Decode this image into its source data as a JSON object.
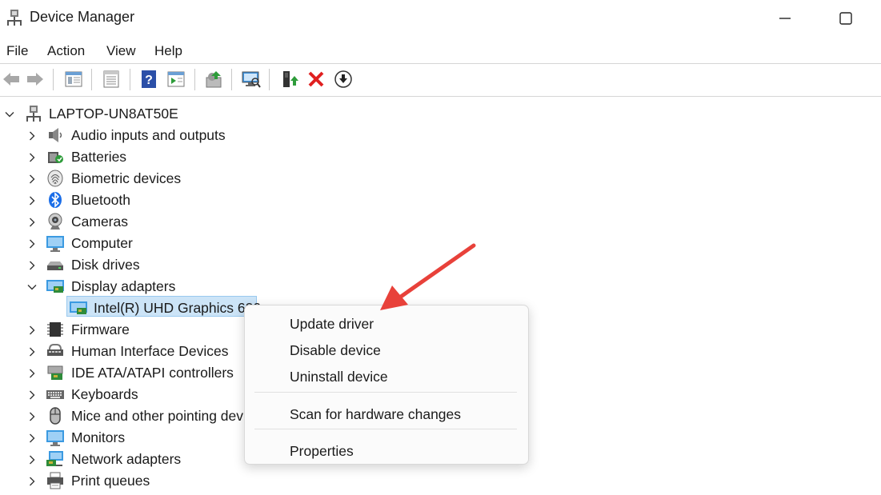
{
  "window": {
    "title": "Device Manager"
  },
  "menu": [
    "File",
    "Action",
    "View",
    "Help"
  ],
  "toolbar_icons": [
    "back-icon",
    "forward-icon",
    "console-tree-icon",
    "properties-sheet-icon",
    "help-icon",
    "action-pane-icon",
    "update-driver-icon",
    "scan-hardware-icon",
    "enable-device-icon",
    "uninstall-icon",
    "download-icon"
  ],
  "tree": {
    "root": "LAPTOP-UN8AT50E",
    "categories": [
      {
        "label": "Audio inputs and outputs",
        "icon": "speaker-icon"
      },
      {
        "label": "Batteries",
        "icon": "battery-icon"
      },
      {
        "label": "Biometric devices",
        "icon": "fingerprint-icon"
      },
      {
        "label": "Bluetooth",
        "icon": "bluetooth-icon"
      },
      {
        "label": "Cameras",
        "icon": "camera-icon"
      },
      {
        "label": "Computer",
        "icon": "computer-icon"
      },
      {
        "label": "Disk drives",
        "icon": "disk-drive-icon"
      },
      {
        "label": "Display adapters",
        "icon": "display-adapter-icon"
      },
      {
        "label": "Firmware",
        "icon": "firmware-icon"
      },
      {
        "label": "Human Interface Devices",
        "icon": "hid-icon"
      },
      {
        "label": "IDE ATA/ATAPI controllers",
        "icon": "ide-controller-icon"
      },
      {
        "label": "Keyboards",
        "icon": "keyboard-icon"
      },
      {
        "label": "Mice and other pointing devices",
        "icon": "mouse-icon"
      },
      {
        "label": "Monitors",
        "icon": "monitor-icon"
      },
      {
        "label": "Network adapters",
        "icon": "network-adapter-icon"
      },
      {
        "label": "Print queues",
        "icon": "printer-icon"
      }
    ],
    "display_child": "Intel(R) UHD Graphics 620"
  },
  "context_menu": {
    "update_driver": "Update driver",
    "disable_device": "Disable device",
    "uninstall_device": "Uninstall device",
    "scan_changes": "Scan for hardware changes",
    "properties": "Properties"
  },
  "colors": {
    "selection": "#cce4f7",
    "arrow": "#e8413a"
  }
}
